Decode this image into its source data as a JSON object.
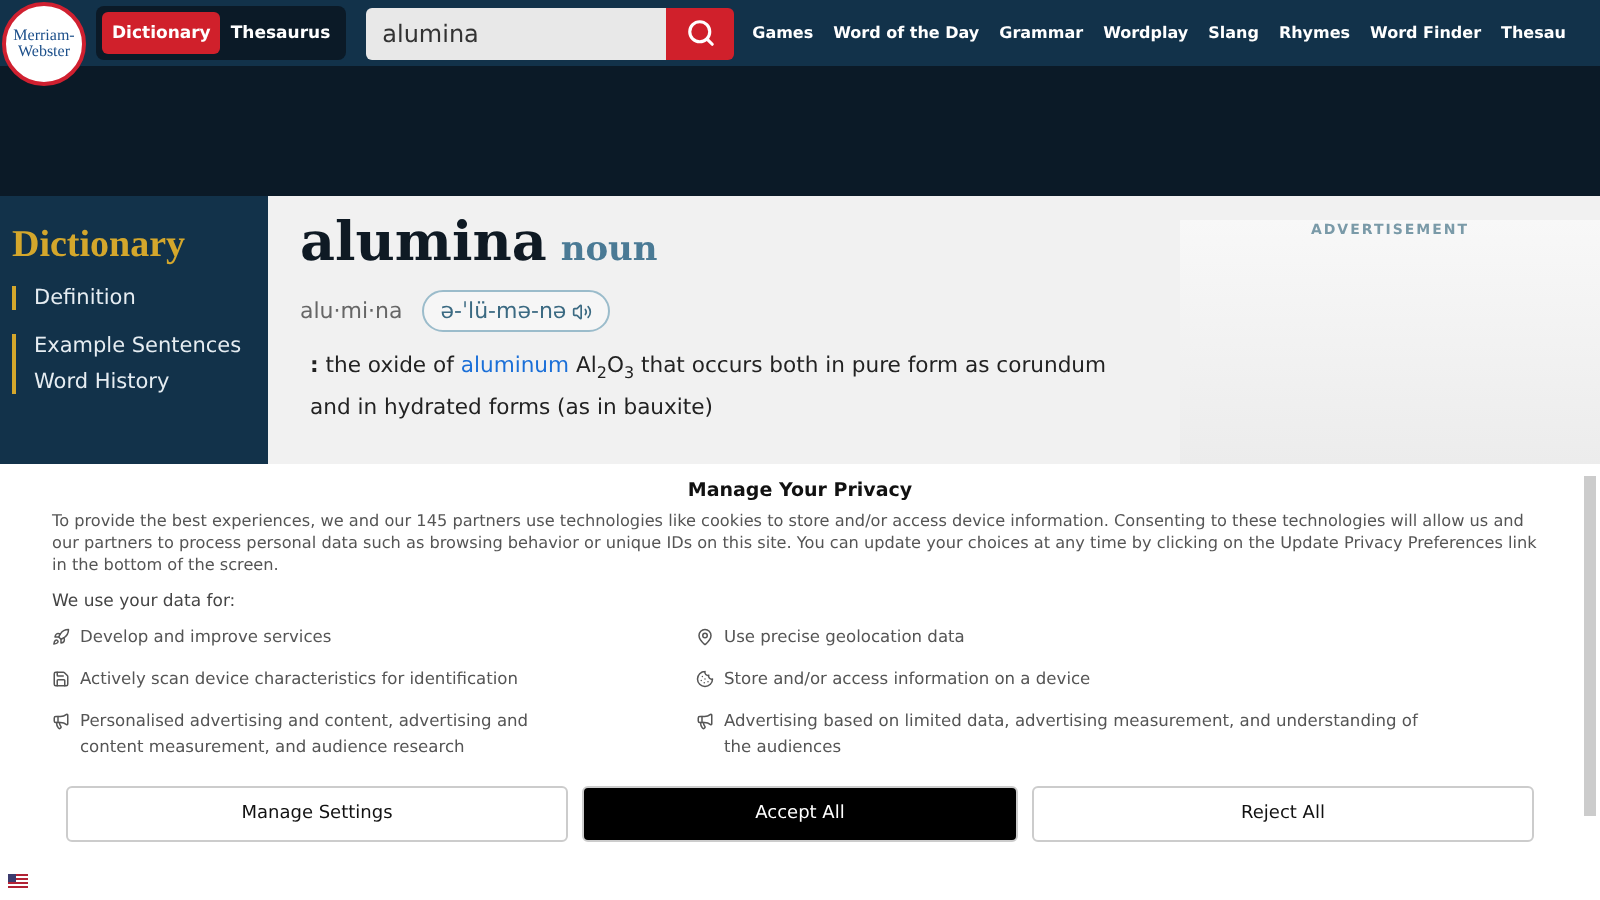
{
  "header": {
    "logo": [
      "Merriam-",
      "Webster"
    ],
    "tabs": [
      {
        "label": "Dictionary",
        "selected": true
      },
      {
        "label": "Thesaurus",
        "selected": false
      }
    ],
    "search": {
      "value": "alumina"
    },
    "nav": [
      "Games",
      "Word of the Day",
      "Grammar",
      "Wordplay",
      "Slang",
      "Rhymes",
      "Word Finder",
      "Thesau"
    ]
  },
  "sidebar": {
    "title": "Dictionary",
    "groups": [
      {
        "items": [
          "Definition"
        ]
      },
      {
        "items": [
          "Example Sentences",
          "Word History"
        ]
      }
    ]
  },
  "entry": {
    "headword": "alumina",
    "pos": "noun",
    "syllables": "alu·mi·na",
    "pronunciation": "ə-ˈlü-mə-nə",
    "definition": {
      "colon": ":",
      "before": "the oxide of",
      "link": "aluminum",
      "after": "Al$_{2}$O$_{3}$ that occurs both in pure form as corundum and in hydrated forms (as in bauxite)"
    }
  },
  "ad": {
    "label": "ADVERTISEMENT"
  },
  "privacy": {
    "title": "Manage Your Privacy",
    "body": "To provide the best experiences, we and our 145 partners use technologies like cookies to store and/or access device information. Consenting to these technologies will allow us and our partners to process personal data such as browsing behavior or unique IDs on this site. You can update your choices at any time by clicking on the Update Privacy Preferences link in the bottom of the screen.",
    "subtitle": "We use your data for:",
    "purposes": [
      {
        "kind": "rocket",
        "text": "Develop and improve services"
      },
      {
        "kind": "pin",
        "text": "Use precise geolocation data"
      },
      {
        "kind": "save",
        "text": "Actively scan device characteristics for identification"
      },
      {
        "kind": "cookie",
        "text": "Store and/or access information on a device"
      },
      {
        "kind": "megaphone",
        "text": "Personalised advertising and content, advertising and content measurement, and audience research"
      },
      {
        "kind": "megaphone",
        "text": "Advertising based on limited data, advertising measurement, and understanding of the audiences"
      }
    ],
    "buttons": [
      {
        "label": "Manage Settings",
        "primary": false
      },
      {
        "label": "Accept All",
        "primary": true
      },
      {
        "label": "Reject All",
        "primary": false
      }
    ]
  }
}
